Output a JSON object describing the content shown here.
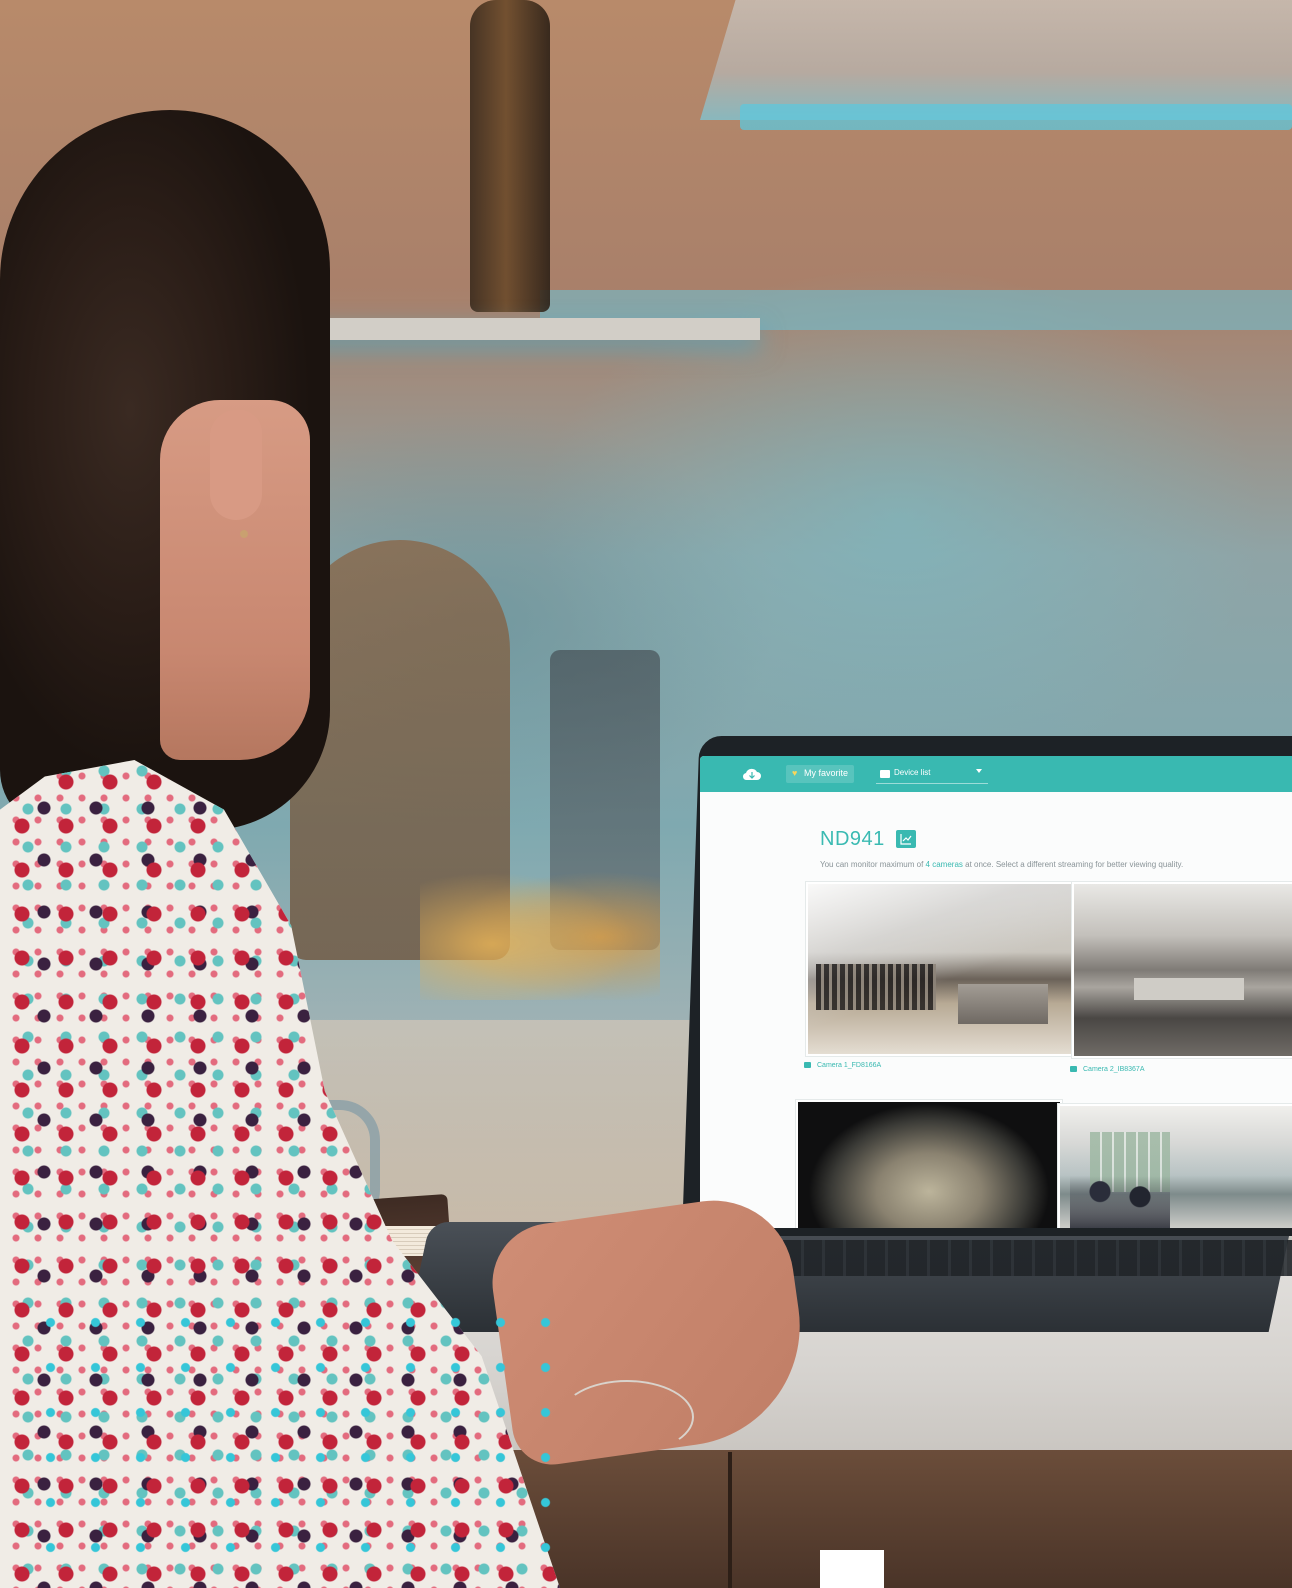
{
  "app": {
    "favorite_label": "My favorite",
    "device_list_label": "Device list",
    "device_name": "ND941",
    "hint_prefix": "You can monitor maximum of",
    "hint_accent": "4 cameras",
    "hint_suffix": "at once. Select a different streaming for better viewing quality.",
    "cameras": [
      {
        "caption": "Camera 1_FD8166A"
      },
      {
        "caption": "Camera 2_IB8367A"
      }
    ],
    "accent_color": "#39b9b1"
  },
  "decor": {
    "dot_color": "#35c6d8"
  }
}
